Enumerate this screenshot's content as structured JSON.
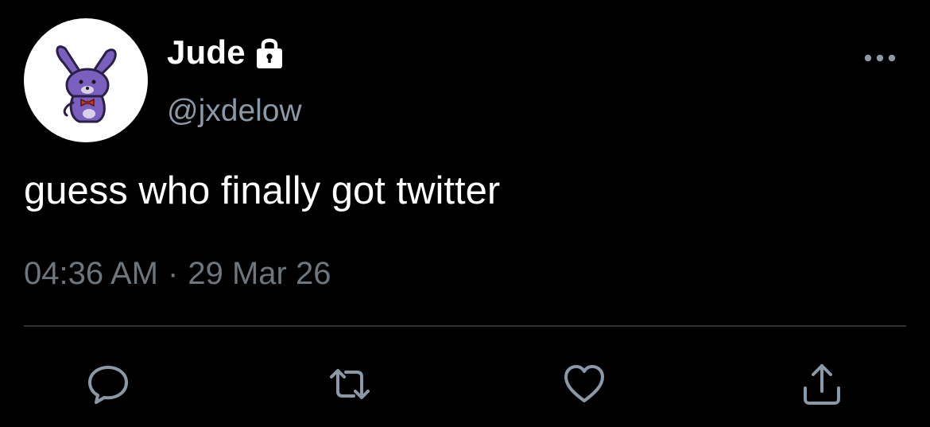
{
  "user": {
    "display_name": "Jude",
    "handle": "@jxdelow",
    "avatar_icon": "purple-bunny-avatar",
    "protected_icon": "lock-icon"
  },
  "tweet": {
    "text": "guess who finally got twitter",
    "time": "04:36 AM",
    "separator": "·",
    "date": "29 Mar 26"
  },
  "actions": [
    {
      "name": "reply",
      "icon": "reply-icon"
    },
    {
      "name": "retweet",
      "icon": "retweet-icon"
    },
    {
      "name": "like",
      "icon": "heart-icon"
    },
    {
      "name": "share",
      "icon": "share-icon"
    }
  ],
  "colors": {
    "background": "#000000",
    "text": "#ffffff",
    "handle": "#8b98a5",
    "meta": "#6e767d",
    "icon": "#8b98a5",
    "divider": "#2f3336",
    "bunny": "#7b5fbf"
  }
}
